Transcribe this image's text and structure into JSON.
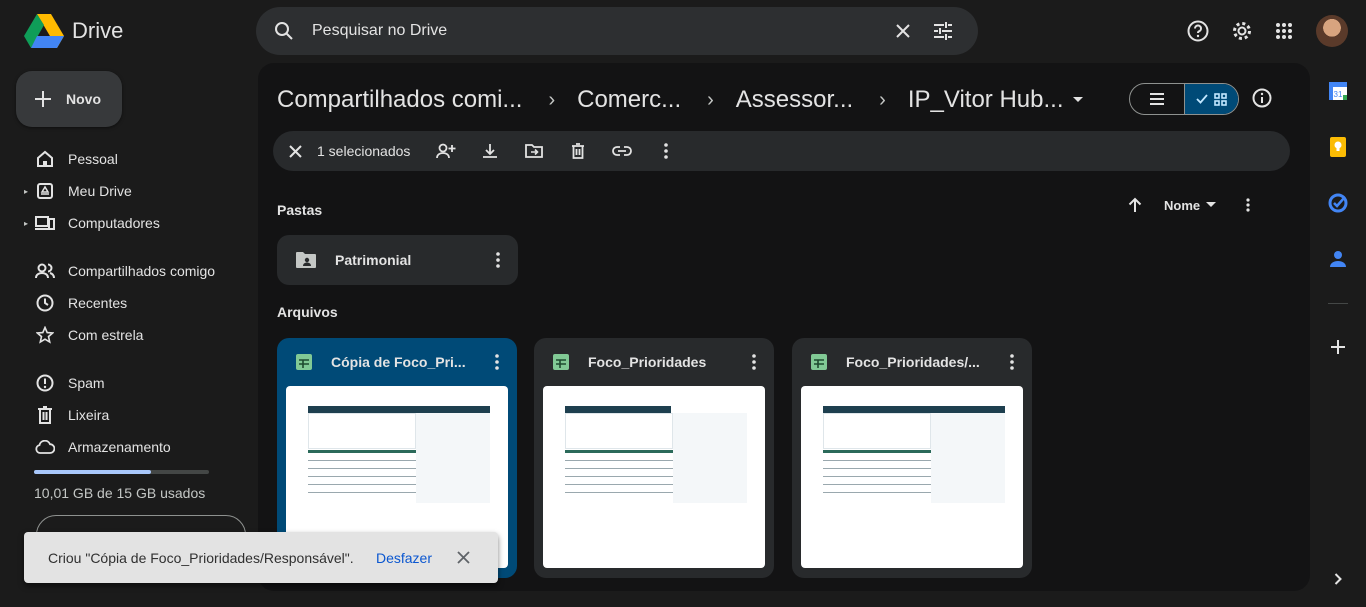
{
  "app": {
    "title": "Drive"
  },
  "search": {
    "placeholder": "Pesquisar no Drive"
  },
  "sidebar": {
    "new_label": "Novo",
    "items": [
      {
        "label": "Pessoal",
        "icon": "home-icon"
      },
      {
        "label": "Meu Drive",
        "icon": "my-drive-icon"
      },
      {
        "label": "Computadores",
        "icon": "computers-icon"
      },
      {
        "label": "Compartilhados comigo",
        "icon": "shared-icon"
      },
      {
        "label": "Recentes",
        "icon": "clock-icon"
      },
      {
        "label": "Com estrela",
        "icon": "star-icon"
      },
      {
        "label": "Spam",
        "icon": "spam-icon"
      },
      {
        "label": "Lixeira",
        "icon": "trash-icon"
      },
      {
        "label": "Armazenamento",
        "icon": "cloud-icon"
      }
    ],
    "storage_text": "10,01 GB de 15 GB usados",
    "storage_fraction": 0.667
  },
  "breadcrumb": [
    "Compartilhados comi...",
    "Comerc...",
    "Assessor...",
    "IP_Vitor Hub..."
  ],
  "selection": {
    "count_label": "1 selecionados"
  },
  "sections": {
    "folders_label": "Pastas",
    "files_label": "Arquivos"
  },
  "sort": {
    "label": "Nome"
  },
  "folders": [
    {
      "name": "Patrimonial"
    }
  ],
  "files": [
    {
      "name": "Cópia de Foco_Pri...",
      "selected": true
    },
    {
      "name": "Foco_Prioridades",
      "selected": false
    },
    {
      "name": "Foco_Prioridades/...",
      "selected": false
    }
  ],
  "snackbar": {
    "text": "Criou \"Cópia de Foco_Prioridades/Responsável\".",
    "action": "Desfazer"
  },
  "colors": {
    "accent": "#004a77",
    "sheets_green": "#81c995",
    "background": "#1b1b1b"
  }
}
